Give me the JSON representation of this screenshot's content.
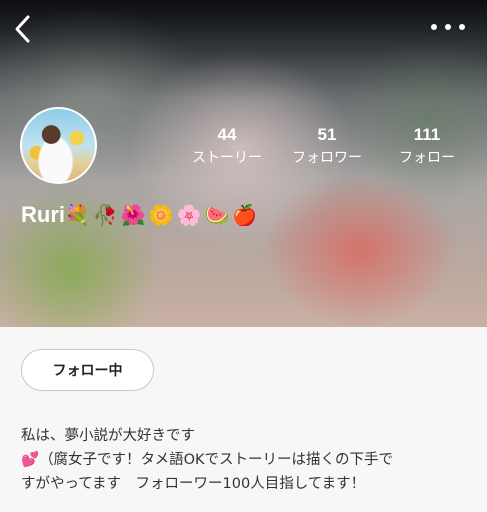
{
  "header": {
    "back_icon": "chevron-left-icon",
    "more_icon": "more-horizontal-icon"
  },
  "profile": {
    "name": "Ruri",
    "name_emojis": "💐🥀🌺🌼🌸🍉🍎",
    "avatar": "avatar-image"
  },
  "stats": [
    {
      "value": "44",
      "label": "ストーリー"
    },
    {
      "value": "51",
      "label": "フォロワー"
    },
    {
      "value": "111",
      "label": "フォロー"
    }
  ],
  "follow_button": {
    "label": "フォロー中"
  },
  "bio": {
    "line1": "私は、夢小説が大好きです",
    "line2_emoji": "💕",
    "line2": "（腐女子です！タメ語OKでストーリーは描くの下手で",
    "line3": "すがやってます　フォローワー100人目指してます！"
  },
  "colors": {
    "background": "#f7f7f7",
    "text": "#333333",
    "white": "#ffffff"
  }
}
